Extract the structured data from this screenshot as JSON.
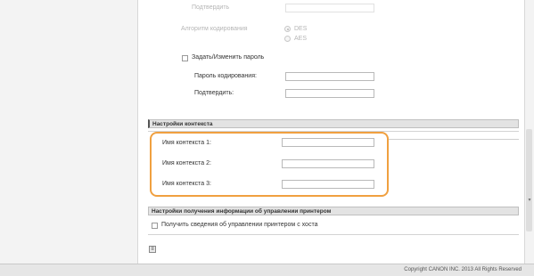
{
  "encryption": {
    "confirm_top_label": "Подтвердить",
    "algorithm_label": "Алгоритм кодирования",
    "algorithm_options": [
      "DES",
      "AES"
    ],
    "algorithm_selected": "DES",
    "set_password_label": "Задать/Изменить пароль",
    "password_label": "Пароль кодирования:",
    "confirm_label": "Подтвердить:"
  },
  "context_settings": {
    "title": "Настройки контекста",
    "fields": [
      {
        "label": "Имя контекста 1:",
        "value": ""
      },
      {
        "label": "Имя контекста 2:",
        "value": ""
      },
      {
        "label": "Имя контекста 3:",
        "value": ""
      }
    ]
  },
  "printer_info": {
    "title": "Настройки получения информации об управлении принтером",
    "checkbox_label": "Получить сведения об управлении принтером с хоста"
  },
  "footer": {
    "copyright": "Copyright CANON INC. 2013 All Rights Reserved"
  },
  "colors": {
    "highlight": "#f0a040",
    "section_header_bg": "#e3e3e3"
  }
}
